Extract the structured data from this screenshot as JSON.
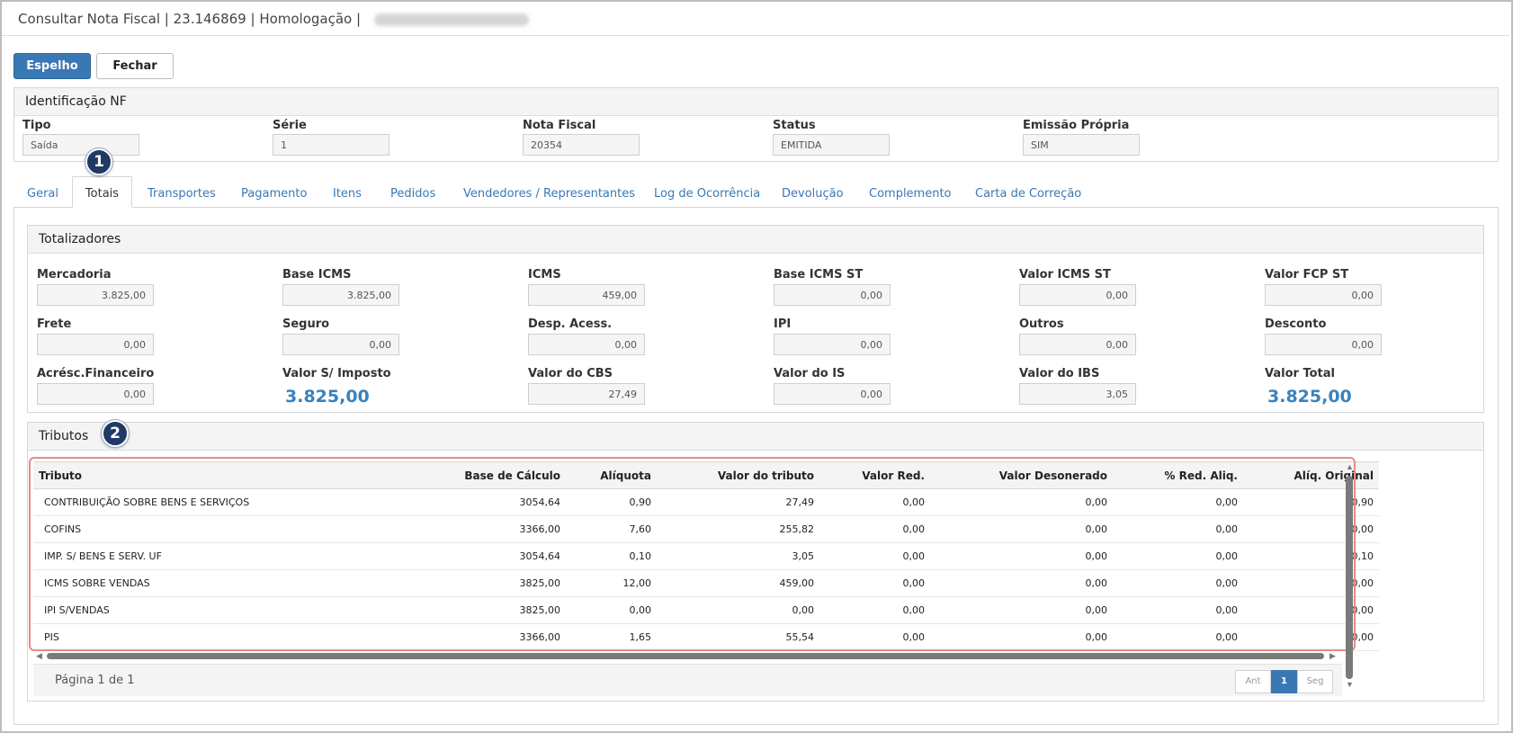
{
  "window": {
    "title": "Consultar Nota Fiscal | 23.146869 | Homologação |"
  },
  "toolbar": {
    "espelho_label": "Espelho",
    "fechar_label": "Fechar"
  },
  "identificacao": {
    "title": "Identificação NF",
    "fields": [
      {
        "label": "Tipo",
        "value": "Saída"
      },
      {
        "label": "Série",
        "value": "1"
      },
      {
        "label": "Nota Fiscal",
        "value": "20354"
      },
      {
        "label": "Status",
        "value": "EMITIDA"
      },
      {
        "label": "Emissão Própria",
        "value": "SIM"
      }
    ]
  },
  "badges": {
    "one": "1",
    "two": "2"
  },
  "tabs": [
    {
      "label": "Geral",
      "active": false
    },
    {
      "label": "Totais",
      "active": true
    },
    {
      "label": "Transportes",
      "active": false
    },
    {
      "label": "Pagamento",
      "active": false
    },
    {
      "label": "Itens",
      "active": false
    },
    {
      "label": "Pedidos",
      "active": false
    },
    {
      "label": "Vendedores / Representantes",
      "active": false
    },
    {
      "label": "Log de Ocorrência",
      "active": false
    },
    {
      "label": "Devolução",
      "active": false
    },
    {
      "label": "Complemento",
      "active": false
    },
    {
      "label": "Carta de Correção",
      "active": false
    }
  ],
  "totalizadores": {
    "title": "Totalizadores",
    "rows": [
      [
        {
          "label": "Mercadoria",
          "value": "3.825,00"
        },
        {
          "label": "Base ICMS",
          "value": "3.825,00"
        },
        {
          "label": "ICMS",
          "value": "459,00"
        },
        {
          "label": "Base ICMS ST",
          "value": "0,00"
        },
        {
          "label": "Valor ICMS ST",
          "value": "0,00"
        },
        {
          "label": "Valor FCP ST",
          "value": "0,00"
        }
      ],
      [
        {
          "label": "Frete",
          "value": "0,00"
        },
        {
          "label": "Seguro",
          "value": "0,00"
        },
        {
          "label": "Desp. Acess.",
          "value": "0,00"
        },
        {
          "label": "IPI",
          "value": "0,00"
        },
        {
          "label": "Outros",
          "value": "0,00"
        },
        {
          "label": "Desconto",
          "value": "0,00"
        }
      ],
      [
        {
          "label": "Acrésc.Financeiro",
          "value": "0,00"
        },
        {
          "label": "Valor S/ Imposto",
          "value": "3.825,00"
        },
        {
          "label": "Valor do CBS",
          "value": "27,49"
        },
        {
          "label": "Valor do IS",
          "value": "0,00"
        },
        {
          "label": "Valor do IBS",
          "value": "3,05"
        },
        {
          "label": "Valor Total",
          "value": "3.825,00"
        }
      ]
    ]
  },
  "tributos": {
    "title": "Tributos",
    "columns": [
      "Tributo",
      "Base de Cálculo",
      "Alíquota",
      "Valor do tributo",
      "Valor Red.",
      "Valor Desonerado",
      "% Red. Aliq.",
      "Alíq. Original"
    ],
    "rows": [
      [
        "CONTRIBUIÇÃO SOBRE BENS E SERVIÇOS",
        "3054,64",
        "0,90",
        "27,49",
        "0,00",
        "0,00",
        "0,00",
        "0,90"
      ],
      [
        "COFINS",
        "3366,00",
        "7,60",
        "255,82",
        "0,00",
        "0,00",
        "0,00",
        "0,00"
      ],
      [
        "IMP. S/ BENS E SERV. UF",
        "3054,64",
        "0,10",
        "3,05",
        "0,00",
        "0,00",
        "0,00",
        "0,10"
      ],
      [
        "ICMS SOBRE VENDAS",
        "3825,00",
        "12,00",
        "459,00",
        "0,00",
        "0,00",
        "0,00",
        "0,00"
      ],
      [
        "IPI S/VENDAS",
        "3825,00",
        "0,00",
        "0,00",
        "0,00",
        "0,00",
        "0,00",
        "0,00"
      ],
      [
        "PIS",
        "3366,00",
        "1,65",
        "55,54",
        "0,00",
        "0,00",
        "0,00",
        "0,00"
      ]
    ],
    "pager": {
      "text": "Página 1 de 1",
      "prev": "Ant",
      "current": "1",
      "next": "Seg"
    }
  },
  "colors": {
    "primary": "#3a78b4",
    "highlight_value": "#3a82bd",
    "badge": "#1f3a66",
    "grid_highlight": "#e88a8a"
  }
}
